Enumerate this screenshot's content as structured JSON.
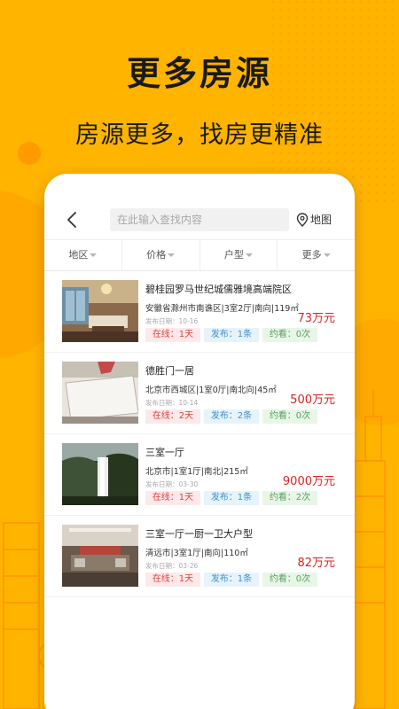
{
  "colors": {
    "background": "#FFB400",
    "price": "#e02020",
    "tag_online": "#e04040",
    "tag_publish": "#3d8fcc",
    "tag_view": "#5aa05a"
  },
  "promo": {
    "headline": "更多房源",
    "subline": "房源更多，找房更精准"
  },
  "topbar": {
    "back_icon": "back-arrow-icon",
    "search_placeholder": "在此输入查找内容",
    "map_label": "地图",
    "map_icon": "location-pin-icon"
  },
  "filters": [
    {
      "label": "地区"
    },
    {
      "label": "价格"
    },
    {
      "label": "户型"
    },
    {
      "label": "更多"
    }
  ],
  "listings": [
    {
      "title": "碧桂园罗马世纪城儒雅境高端院区",
      "desc": "安徽省滁州市南谯区|3室2厅|南向|119㎡",
      "date": "发布日期：10-16",
      "price": "73万元",
      "online": "在线：1天",
      "published": "发布：1条",
      "viewed": "约看：0次"
    },
    {
      "title": "德胜门一居",
      "desc": "北京市西城区|1室0厅|南北向|45㎡",
      "date": "发布日期：10-14",
      "price": "500万元",
      "online": "在线：2天",
      "published": "发布：2条",
      "viewed": "约看：0次"
    },
    {
      "title": "三室一厅",
      "desc": "北京市|1室1厅|南北|215㎡",
      "date": "发布日期：03-30",
      "price": "9000万元",
      "online": "在线：1天",
      "published": "发布：1条",
      "viewed": "约看：2次"
    },
    {
      "title": "三室一厅一厨一卫大户型",
      "desc": "清远市|3室1厅|南向|110㎡",
      "date": "发布日期：03-26",
      "price": "82万元",
      "online": "在线：1天",
      "published": "发布：1条",
      "viewed": "约看：0次"
    }
  ]
}
